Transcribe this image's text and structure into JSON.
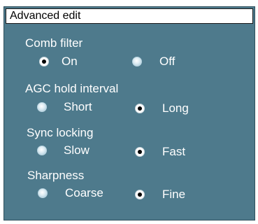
{
  "panel": {
    "title": "Advanced edit"
  },
  "groups": [
    {
      "label": "Comb filter",
      "options": [
        {
          "label": "On",
          "selected": true
        },
        {
          "label": "Off",
          "selected": false
        }
      ]
    },
    {
      "label": "AGC hold interval",
      "options": [
        {
          "label": "Short",
          "selected": false
        },
        {
          "label": "Long",
          "selected": true
        }
      ]
    },
    {
      "label": "Sync locking",
      "options": [
        {
          "label": "Slow",
          "selected": false
        },
        {
          "label": "Fast",
          "selected": true
        }
      ]
    },
    {
      "label": "Sharpness",
      "options": [
        {
          "label": "Coarse",
          "selected": false
        },
        {
          "label": "Fine",
          "selected": true
        }
      ]
    }
  ],
  "colors": {
    "panel_background": "#4e7a8c",
    "title_background": "#ffffff",
    "text": "#ffffff",
    "radio_dot": "#000000"
  }
}
